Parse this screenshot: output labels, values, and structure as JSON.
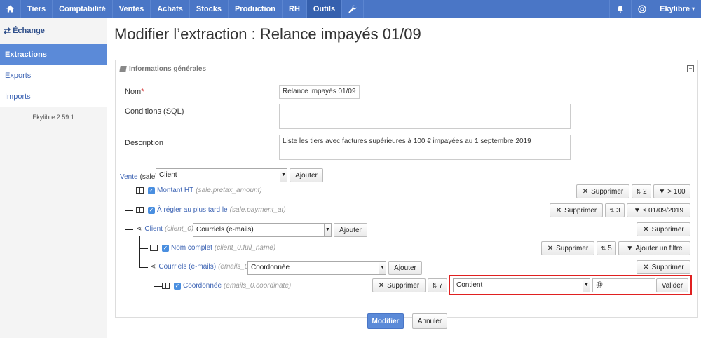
{
  "topbar": {
    "home_icon": "home-icon",
    "items": [
      "Tiers",
      "Comptabilité",
      "Ventes",
      "Achats",
      "Stocks",
      "Production",
      "RH",
      "Outils"
    ],
    "active": "Outils",
    "tools_icon": "wrench-icon",
    "bell_icon": "bell-icon",
    "globe_icon": "globe-icon",
    "user": "Ekylibre"
  },
  "sidebar": {
    "heading": "Échange",
    "items": [
      "Extractions",
      "Exports",
      "Imports"
    ],
    "version": "Ekylibre 2.59.1"
  },
  "page": {
    "title": "Modifier l’extraction : Relance impayés 01/09"
  },
  "panel": {
    "heading": "Informations générales",
    "name_label": "Nom",
    "name_required": "*",
    "name_value": "Relance impayés 01/09",
    "conditions_label": "Conditions (SQL)",
    "conditions_value": "",
    "description_label": "Description",
    "description_value": "Liste les tiers avec factures supérieures à 100 € impayées au 1 septembre 2019"
  },
  "tree": {
    "root_link": "Vente",
    "root_code": "(sale)",
    "root_select": "Client",
    "add": "Ajouter",
    "delete": "Supprimer",
    "rows": [
      {
        "name": "Montant HT",
        "path": "(sale.pretax_amount)",
        "order": "2",
        "filter": "> 100"
      },
      {
        "name": "À régler au plus tard le",
        "path": "(sale.payment_at)",
        "order": "3",
        "filter": "≤ 01/09/2019"
      },
      {
        "name": "Client",
        "path": "(client_0)",
        "select": "Courriels (e-mails)"
      },
      {
        "name": "Nom complet",
        "path": "(client_0.full_name)",
        "order": "5",
        "filter": "Ajouter un filtre"
      },
      {
        "name": "Courriels (e-mails)",
        "path": "(emails_0)",
        "select": "Coordonnée"
      },
      {
        "name": "Coordonnée",
        "path": "(emails_0.coordinate)",
        "order": "7",
        "filter_op": "Contient",
        "filter_value": "@",
        "validate": "Valider"
      }
    ]
  },
  "footer": {
    "submit": "Modifier",
    "cancel": "Annuler"
  }
}
